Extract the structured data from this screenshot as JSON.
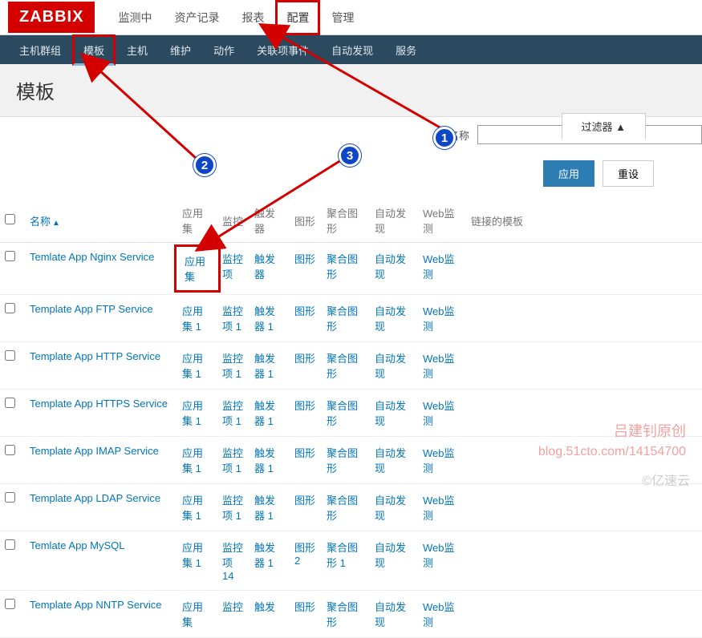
{
  "logo": "ZABBIX",
  "top_nav": {
    "items": [
      "监测中",
      "资产记录",
      "报表",
      "配置",
      "管理"
    ],
    "active_idx": 3
  },
  "sub_nav": {
    "items": [
      "主机群组",
      "模板",
      "主机",
      "维护",
      "动作",
      "关联项事件",
      "自动发现",
      "服务"
    ],
    "active_idx": 1
  },
  "page_title": "模板",
  "filter": {
    "tab_label": "过滤器 ▲",
    "name_label": "名称",
    "name_value": "",
    "apply_label": "应用",
    "reset_label": "重设"
  },
  "table": {
    "headers": {
      "name": "名称",
      "appset": "应用集",
      "monitor": "监控",
      "trigger": "触发器",
      "graph": "图形",
      "aggregate": "聚合图形",
      "discovery": "自动发现",
      "web": "Web监测",
      "linked": "链接的模板"
    },
    "rows": [
      {
        "name": "Temlate App Nginx Service",
        "appset": "应用集",
        "monitor": "监控项",
        "trigger": "触发器",
        "graph": "图形",
        "aggregate": "聚合图形",
        "discovery": "自动发现",
        "web": "Web监测",
        "first": true
      },
      {
        "name": "Template App FTP Service",
        "appset": "应用集 1",
        "monitor": "监控项 1",
        "trigger": "触发器 1",
        "graph": "图形",
        "aggregate": "聚合图形",
        "discovery": "自动发现",
        "web": "Web监测"
      },
      {
        "name": "Template App HTTP Service",
        "appset": "应用集 1",
        "monitor": "监控项 1",
        "trigger": "触发器 1",
        "graph": "图形",
        "aggregate": "聚合图形",
        "discovery": "自动发现",
        "web": "Web监测"
      },
      {
        "name": "Template App HTTPS Service",
        "appset": "应用集 1",
        "monitor": "监控项 1",
        "trigger": "触发器 1",
        "graph": "图形",
        "aggregate": "聚合图形",
        "discovery": "自动发现",
        "web": "Web监测"
      },
      {
        "name": "Template App IMAP Service",
        "appset": "应用集 1",
        "monitor": "监控项 1",
        "trigger": "触发器 1",
        "graph": "图形",
        "aggregate": "聚合图形",
        "discovery": "自动发现",
        "web": "Web监测"
      },
      {
        "name": "Template App LDAP Service",
        "appset": "应用集 1",
        "monitor": "监控项 1",
        "trigger": "触发器 1",
        "graph": "图形",
        "aggregate": "聚合图形",
        "discovery": "自动发现",
        "web": "Web监测"
      },
      {
        "name": "Temlate App MySQL",
        "appset": "应用集 1",
        "monitor": "监控项 14",
        "trigger": "触发器 1",
        "graph": "图形 2",
        "aggregate": "聚合图形 1",
        "discovery": "自动发现",
        "web": "Web监测"
      },
      {
        "name": "Template App NNTP Service",
        "appset": "应用集",
        "monitor": "监控",
        "trigger": "触发",
        "graph": "图形",
        "aggregate": "聚合图形",
        "discovery": "自动发现",
        "web": "Web监测"
      }
    ]
  },
  "badges": {
    "b1": "1",
    "b2": "2",
    "b3": "3"
  },
  "watermark": {
    "line1": "吕建钊原创",
    "line2": "blog.51cto.com/14154700",
    "line3": "©亿速云"
  }
}
